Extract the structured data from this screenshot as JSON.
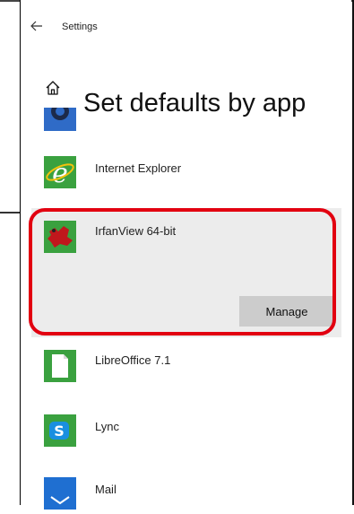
{
  "window": {
    "title": "Settings",
    "back_icon": "arrow-left-icon"
  },
  "page": {
    "title": "Set defaults by app",
    "home_icon": "home-icon"
  },
  "apps": [
    {
      "name": "",
      "icon": "partial-app-icon"
    },
    {
      "name": "Internet Explorer",
      "icon": "internet-explorer-icon"
    },
    {
      "name": "IrfanView 64-bit",
      "icon": "irfanview-icon",
      "selected": true,
      "manage_label": "Manage"
    },
    {
      "name": "LibreOffice 7.1",
      "icon": "libreoffice-icon"
    },
    {
      "name": "Lync",
      "icon": "lync-icon"
    },
    {
      "name": "Mail",
      "icon": "mail-icon"
    }
  ],
  "colors": {
    "highlight": "#e20010",
    "selected_bg": "#ececec",
    "manage_button_bg": "#cccccc"
  }
}
